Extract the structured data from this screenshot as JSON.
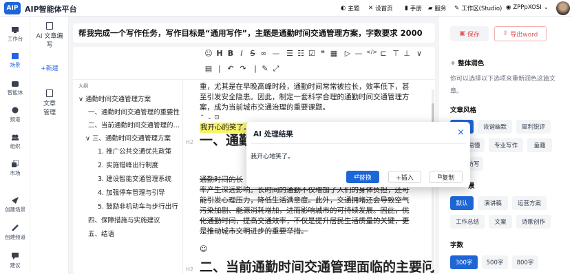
{
  "app": {
    "logo": "AIP",
    "name": "AIP智能体平台"
  },
  "topnav": [
    {
      "icon": "theme-icon",
      "label": "主题"
    },
    {
      "icon": "home-x-icon",
      "label": "设首页"
    },
    {
      "icon": "book-icon",
      "label": "手册"
    },
    {
      "icon": "service-icon",
      "label": "服务"
    },
    {
      "icon": "pen-icon",
      "label": "工作区(Studio)"
    },
    {
      "icon": "globe-icon",
      "label": "ZPPpXOSI"
    }
  ],
  "leftnav": [
    {
      "label": "工作台",
      "icon": "desktop-icon"
    },
    {
      "label": "场景",
      "icon": "scene-icon",
      "active": true
    },
    {
      "label": "智能体",
      "icon": "agent-icon"
    },
    {
      "label": "频道",
      "icon": "channel-icon"
    },
    {
      "label": "组织",
      "icon": "org-icon"
    },
    {
      "label": "市场",
      "icon": "market-icon"
    },
    {
      "label": "创建场景",
      "icon": "send-icon"
    },
    {
      "label": "创建频道",
      "icon": "brush-icon"
    },
    {
      "label": "建议",
      "icon": "comment-icon"
    }
  ],
  "subnav": {
    "items": [
      {
        "label": "AI 文章编写",
        "icon": "ai-doc-icon"
      },
      {
        "label": "文章管理",
        "icon": "doc-icon"
      }
    ],
    "new_label": "+新建"
  },
  "task": "帮我完成一个写作任务，写作目标是“通用写作”，主题是通勤时间交通管理方案，字数要求 2000",
  "outline": {
    "title": "大纲",
    "items": [
      {
        "text": "∨ 通勤时间交通管理方案",
        "level": 0
      },
      {
        "text": "一、通勤时间交通管理的重要性",
        "level": 1
      },
      {
        "text": "二、当前通勤时间交通管理的问题",
        "level": 1
      },
      {
        "text": "∨ 三、通勤时间交通管理方案",
        "level": 1
      },
      {
        "text": "1. 推广公共交通优先政策",
        "level": 2
      },
      {
        "text": "2. 实施错峰出行制度",
        "level": 2
      },
      {
        "text": "3. 建设智能交通管理系统",
        "level": 2
      },
      {
        "text": "4. 加强停车管理与引导",
        "level": 2
      },
      {
        "text": "5. 鼓励非机动车与步行出行",
        "level": 2
      },
      {
        "text": "四、保障措施与实施建议",
        "level": 1
      },
      {
        "text": "五、结语",
        "level": 1
      }
    ]
  },
  "doc": {
    "para_top": [
      "重，尤其是在早晚高峰时段，通勤时间常常被拉长，效率低下，甚",
      "至引发安全隐患。因此，制定一套科学合理的通勤时间交通管理方",
      "案，成为当前城市交通治理的重要课题。"
    ],
    "highlight": "我开心的笑了。",
    "h2_marker": "H2",
    "h2": "一、通勤",
    "strike_lines": [
      "通勤时间的长",
      "率产生深远影响。长时间的通勤不仅增加了人们的身体负担，还可",
      "能引发心理压力，降低生活满意度。此外，交通拥堵还会导致空气",
      "污染加剧、能源消耗增加，进而影响城市的可持续发展。因此，优",
      "化通勤时间，提高交通效率，不仅是提升居民生活质量的关键，更",
      "是推动城市文明进步的重要举措。"
    ],
    "h2_bottom": "二、当前通勤时间交通管理面临的主要问题"
  },
  "popup": {
    "title": "AI 处理结果",
    "close": "×",
    "body": "我开心地笑了。",
    "replace": "替换",
    "insert": "+插入",
    "copy": "复制"
  },
  "right": {
    "save": "保存",
    "export": "导出word",
    "polish_title": "整体润色",
    "polish_desc": "你可以选择以下选项来重新润色这篇文章。",
    "style_title": "文章风格",
    "styles": [
      "",
      "诙谐幽默",
      "犀利锐评",
      "易懂",
      "专业写作",
      "童趣",
      "仿写"
    ],
    "scene_title_frag": "景",
    "scenes": [
      "默认",
      "演讲稿",
      "运营方案",
      "工作总结",
      "文案",
      "诗歌创作"
    ],
    "count_title": "字数",
    "counts": [
      "300字",
      "500字",
      "800字"
    ]
  },
  "colors": {
    "accent": "#1e66d6",
    "danger": "#e25555",
    "highlight": "#f7f36b"
  }
}
